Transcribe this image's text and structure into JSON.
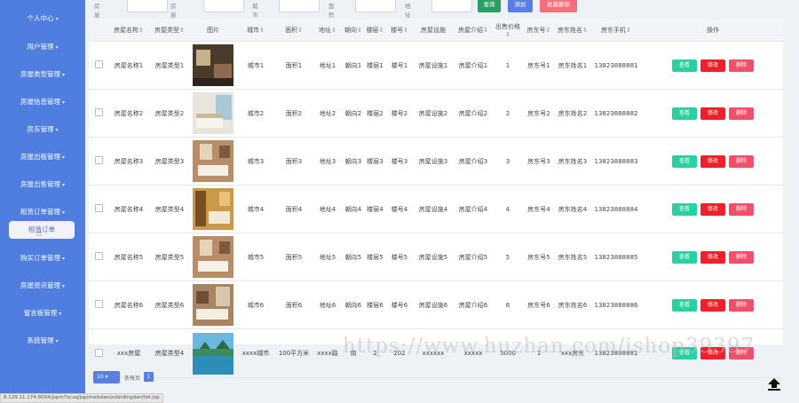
{
  "sidebar": {
    "items": [
      {
        "label": "个人中心",
        "caret": "▾"
      },
      {
        "label": "用户管理",
        "caret": "▾"
      },
      {
        "label": "房屋类型管理",
        "caret": "▾"
      },
      {
        "label": "房屋信息管理",
        "caret": "▾"
      },
      {
        "label": "房东管理",
        "caret": "▾"
      },
      {
        "label": "房屋出租管理",
        "caret": "▾"
      },
      {
        "label": "房屋出售管理",
        "caret": "▾"
      },
      {
        "label": "租赁订单管理",
        "caret": "▾"
      },
      {
        "label": "购买订单管理",
        "caret": "▾"
      },
      {
        "label": "房屋资讯管理",
        "caret": "▾"
      },
      {
        "label": "留言板管理",
        "caret": "▾"
      },
      {
        "label": "系统管理",
        "caret": "▾"
      }
    ],
    "active_label": "租赁订单"
  },
  "filters": {
    "labels": [
      "房屋名称",
      "房屋类型",
      "城市",
      "面积",
      "地址"
    ],
    "buttons": {
      "query": "查询",
      "add": "添加",
      "batch_delete": "批量删除"
    }
  },
  "colors": {
    "sidebar": "#4f7ee0",
    "query_btn": "#2b9e64",
    "add_btn": "#5b7ee3",
    "delete_btn": "#f46f7a",
    "view_btn": "#2bd0a0",
    "edit_btn": "#f0202a",
    "del_btn": "#f2506a"
  },
  "table": {
    "headers": [
      "房屋名称",
      "房屋类型",
      "图片",
      "城市",
      "面积",
      "地址",
      "朝向",
      "楼层",
      "楼号",
      "房屋设施",
      "房屋介绍",
      "出售价格",
      "房东号",
      "房东姓名",
      "房东手机",
      "操作"
    ],
    "sortable": [
      true,
      true,
      false,
      true,
      true,
      true,
      true,
      true,
      true,
      false,
      true,
      true,
      true,
      true,
      true,
      false
    ],
    "rows": [
      {
        "c": [
          "房屋名称1",
          "房屋类型1",
          "",
          "城市1",
          "面积1",
          "地址1",
          "朝向1",
          "楼层1",
          "楼号1",
          "房屋设施1",
          "房屋介绍1",
          "1",
          "房东号1",
          "房东姓名1",
          "13823888881"
        ],
        "img": "room-dark"
      },
      {
        "c": [
          "房屋名称2",
          "房屋类型2",
          "",
          "城市2",
          "面积2",
          "地址2",
          "朝向2",
          "楼层2",
          "楼号2",
          "房屋设施2",
          "房屋介绍2",
          "2",
          "房东号2",
          "房东姓名2",
          "13823888882"
        ],
        "img": "room-window"
      },
      {
        "c": [
          "房屋名称3",
          "房屋类型3",
          "",
          "城市3",
          "面积3",
          "地址3",
          "朝向3",
          "楼层3",
          "楼号3",
          "房屋设施3",
          "房屋介绍3",
          "3",
          "房东号3",
          "房东姓名3",
          "13823888883"
        ],
        "img": "room-warm"
      },
      {
        "c": [
          "房屋名称4",
          "房屋类型4",
          "",
          "城市4",
          "面积4",
          "地址4",
          "朝向4",
          "楼层4",
          "楼号4",
          "房屋设施4",
          "房屋介绍4",
          "4",
          "房东号4",
          "房东姓名4",
          "13823888884"
        ],
        "img": "room-gold"
      },
      {
        "c": [
          "房屋名称5",
          "房屋类型5",
          "",
          "城市5",
          "面积5",
          "地址5",
          "朝向5",
          "楼层5",
          "楼号5",
          "房屋设施5",
          "房屋介绍5",
          "5",
          "房东号5",
          "房东姓名5",
          "13823888885"
        ],
        "img": "room-warm"
      },
      {
        "c": [
          "房屋名称6",
          "房屋类型6",
          "",
          "城市6",
          "面积6",
          "地址6",
          "朝向6",
          "楼层6",
          "楼号6",
          "房屋设施6",
          "房屋介绍6",
          "6",
          "房东号6",
          "房东姓名6",
          "13823888886"
        ],
        "img": "room-brown"
      },
      {
        "c": [
          "xxx房屋",
          "房屋类型4",
          "",
          "xxxx城市",
          "100平方米",
          "xxxx路",
          "南",
          "2",
          "202",
          "xxxxxx",
          "xxxxx",
          "5000",
          "1",
          "xxx房东",
          "13823888881"
        ],
        "img": "lake"
      }
    ],
    "actions": {
      "view": "查看",
      "edit": "修改",
      "delete": "删除"
    },
    "sort_glyph": "⇕"
  },
  "pager": {
    "page_size": "10",
    "label": "条每页",
    "current": "1"
  },
  "watermark": "https://www.huzhan.com/ishop39397",
  "statusbar": "8.129.11.174:8004/jspm7scvq/jsp/modules/zulindingdan/list.jsp"
}
